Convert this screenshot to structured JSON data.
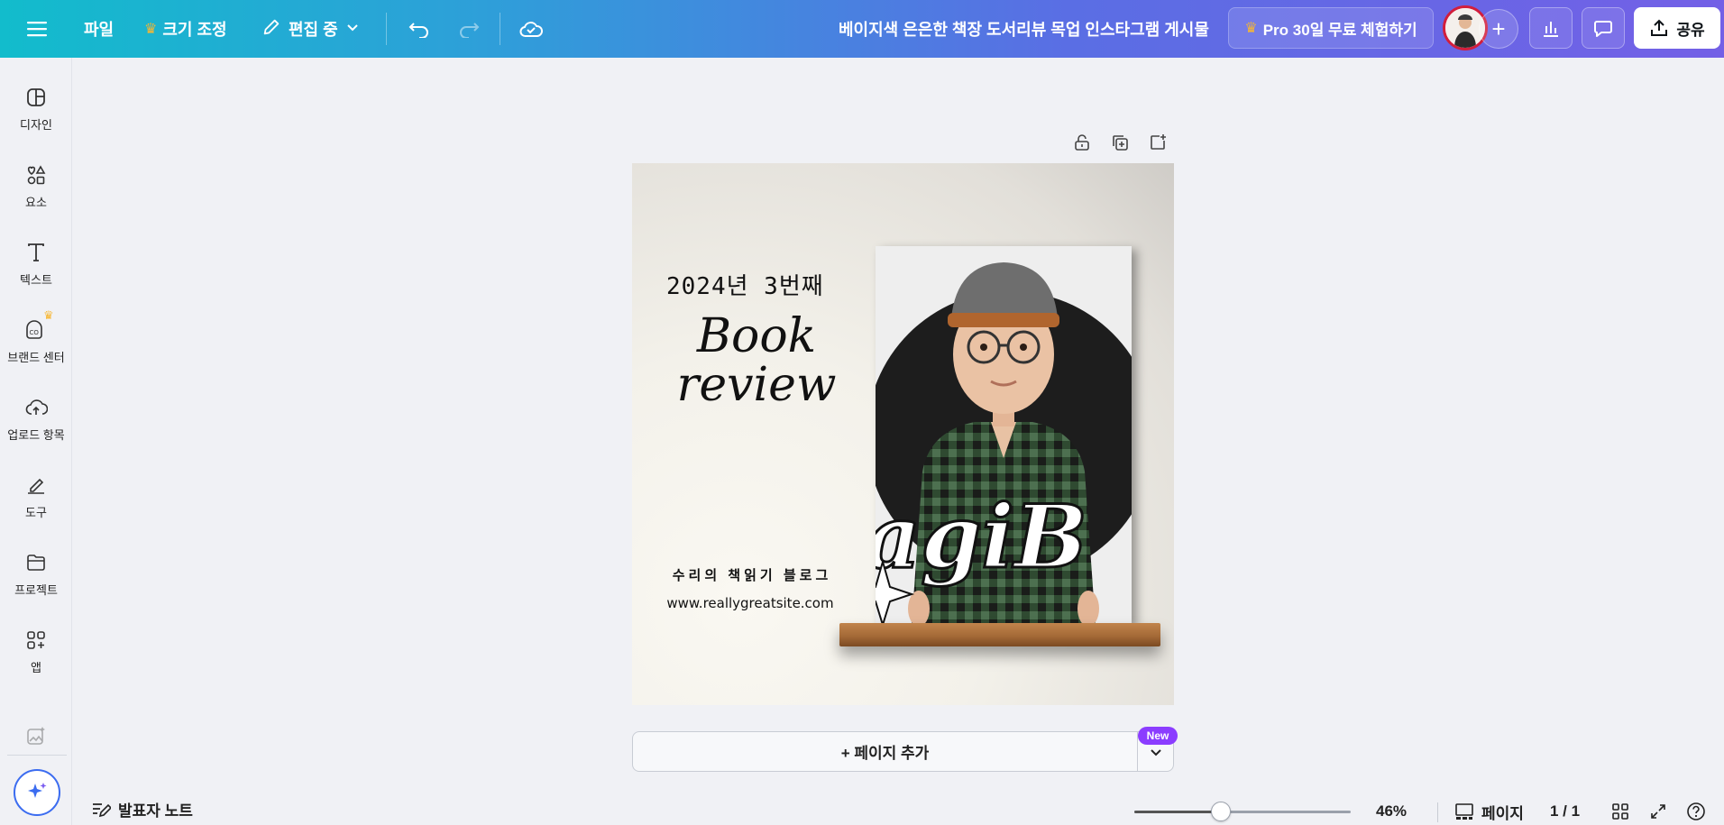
{
  "header": {
    "file_label": "파일",
    "resize_label": "크기 조정",
    "edit_mode_label": "편집 중",
    "document_title": "베이지색 은은한 책장 도서리뷰 목업 인스타그램 게시물",
    "pro_trial_label": "Pro 30일 무료 체험하기",
    "share_label": "공유"
  },
  "sidebar": {
    "items": [
      {
        "label": "디자인",
        "icon": "design-icon"
      },
      {
        "label": "요소",
        "icon": "elements-icon"
      },
      {
        "label": "텍스트",
        "icon": "text-icon"
      },
      {
        "label": "브랜드 센터",
        "icon": "brand-center-icon"
      },
      {
        "label": "업로드 항목",
        "icon": "upload-icon"
      },
      {
        "label": "도구",
        "icon": "tools-icon"
      },
      {
        "label": "프로젝트",
        "icon": "folder-icon"
      },
      {
        "label": "앱",
        "icon": "apps-icon"
      }
    ]
  },
  "design": {
    "year_text": "2024년 3번째",
    "title_line1": "Book",
    "title_line2": "review",
    "blog_text": "수리의 책읽기 블로그",
    "url_text": "www.reallygreatsite.com",
    "cover_text": "agiB"
  },
  "canvas": {
    "add_page_label": "+ 페이지 추가",
    "new_badge": "New"
  },
  "footer": {
    "notes_label": "발표자 노트",
    "zoom_level": "46%",
    "zoom_fraction": 0.4,
    "pages_label": "페이지",
    "page_count": "1 / 1"
  },
  "colors": {
    "brand_gradient_start": "#12bccc",
    "brand_gradient_end": "#7360e6",
    "pro_crown": "#f7b733",
    "new_badge": "#8b3dff",
    "magic_accent": "#3b6cf0"
  }
}
